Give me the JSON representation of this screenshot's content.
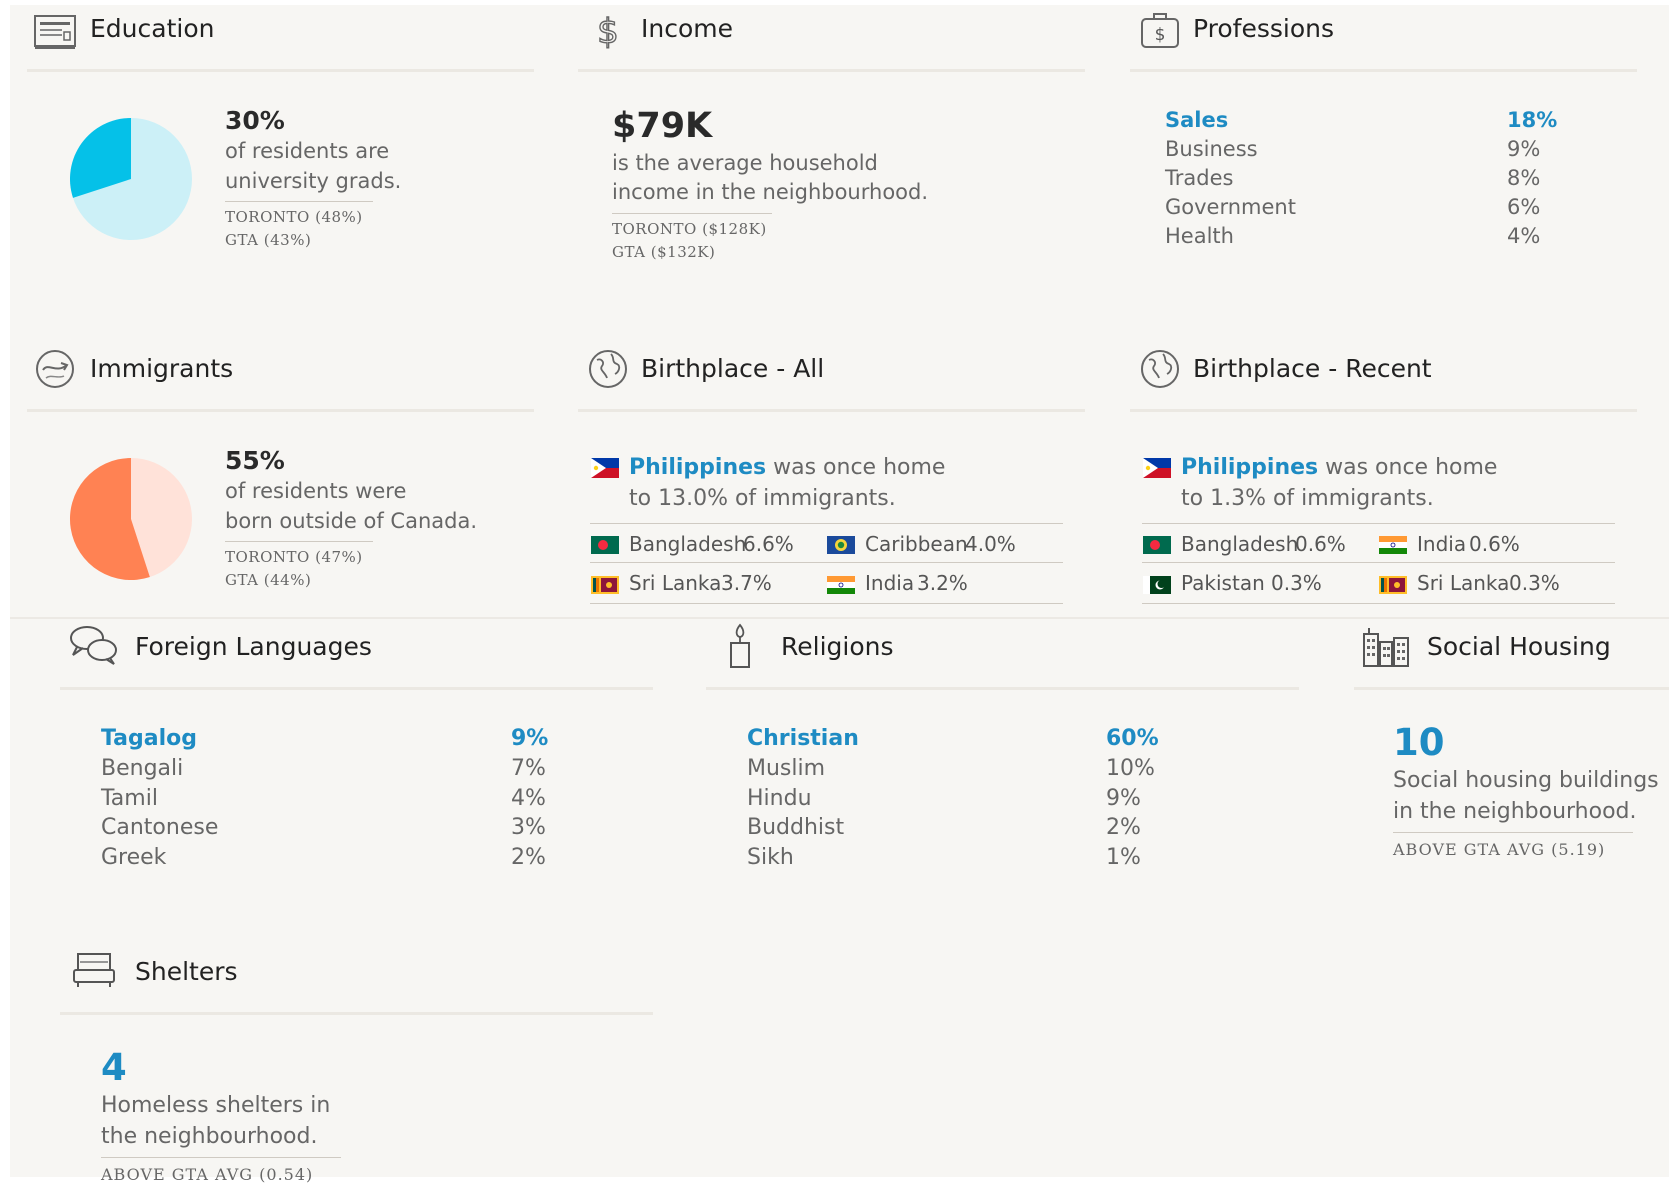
{
  "education": {
    "title": "Education",
    "percent": "30%",
    "desc_line1": "of residents are",
    "desc_line2": "university grads.",
    "compare1": "TORONTO (48%)",
    "compare2": "GTA (43%)",
    "pie_fraction": 0.3,
    "pie_color": "#05c1e8",
    "pie_bg": "#ccf0f7"
  },
  "income": {
    "title": "Income",
    "value": "$79K",
    "desc_line1": "is the average household",
    "desc_line2": "income in the neighbourhood.",
    "compare1": "TORONTO ($128K)",
    "compare2": "GTA ($132K)"
  },
  "professions": {
    "title": "Professions",
    "items": [
      {
        "name": "Sales",
        "value": "18%"
      },
      {
        "name": "Business",
        "value": "9%"
      },
      {
        "name": "Trades",
        "value": "8%"
      },
      {
        "name": "Government",
        "value": "6%"
      },
      {
        "name": "Health",
        "value": "4%"
      }
    ]
  },
  "immigrants": {
    "title": "Immigrants",
    "percent": "55%",
    "desc_line1": "of residents were",
    "desc_line2": "born outside of Canada.",
    "compare1": "TORONTO (47%)",
    "compare2": "GTA (44%)",
    "pie_fraction": 0.55,
    "pie_color": "#ff8253",
    "pie_bg": "#ffe2d9"
  },
  "birthplace_all": {
    "title": "Birthplace - All",
    "top_country": "Philippines",
    "top_text1": " was once home",
    "top_text2": "to 13.0% of immigrants.",
    "others": [
      {
        "name": "Bangladesh",
        "value": "6.6%",
        "flag": "bangladesh"
      },
      {
        "name": "Caribbean",
        "value": "4.0%",
        "flag": "caribbean"
      },
      {
        "name": "Sri Lanka",
        "value": "3.7%",
        "flag": "sri-lanka"
      },
      {
        "name": "India",
        "value": "3.2%",
        "flag": "india"
      }
    ]
  },
  "birthplace_recent": {
    "title": "Birthplace - Recent",
    "top_country": "Philippines",
    "top_text1": " was once home",
    "top_text2": "to 1.3% of immigrants.",
    "others": [
      {
        "name": "Bangladesh",
        "value": "0.6%",
        "flag": "bangladesh"
      },
      {
        "name": "India",
        "value": "0.6%",
        "flag": "india"
      },
      {
        "name": "Pakistan",
        "value": "0.3%",
        "flag": "pakistan"
      },
      {
        "name": "Sri Lanka",
        "value": "0.3%",
        "flag": "sri-lanka"
      }
    ]
  },
  "languages": {
    "title": "Foreign Languages",
    "items": [
      {
        "name": "Tagalog",
        "value": "9%"
      },
      {
        "name": "Bengali",
        "value": "7%"
      },
      {
        "name": "Tamil",
        "value": "4%"
      },
      {
        "name": "Cantonese",
        "value": "3%"
      },
      {
        "name": "Greek",
        "value": "2%"
      }
    ]
  },
  "religions": {
    "title": "Religions",
    "items": [
      {
        "name": "Christian",
        "value": "60%"
      },
      {
        "name": "Muslim",
        "value": "10%"
      },
      {
        "name": "Hindu",
        "value": "9%"
      },
      {
        "name": "Buddhist",
        "value": "2%"
      },
      {
        "name": "Sikh",
        "value": "1%"
      }
    ]
  },
  "social_housing": {
    "title": "Social Housing",
    "value": "10",
    "desc_line1": "Social housing buildings",
    "desc_line2": "in the neighbourhood.",
    "compare": "ABOVE GTA AVG  (5.19)"
  },
  "shelters": {
    "title": "Shelters",
    "value": "4",
    "desc_line1": "Homeless shelters in",
    "desc_line2": "the neighbourhood.",
    "compare": "ABOVE GTA AVG  (0.54)"
  },
  "colors": {
    "accent_blue": "#1e8bc3",
    "background": "#f7f6f3"
  },
  "icons": [
    "education-icon",
    "dollar-icon",
    "briefcase-icon",
    "immigrants-icon",
    "globe-icon",
    "speech-bubbles-icon",
    "candle-icon",
    "buildings-icon",
    "bed-icon"
  ]
}
